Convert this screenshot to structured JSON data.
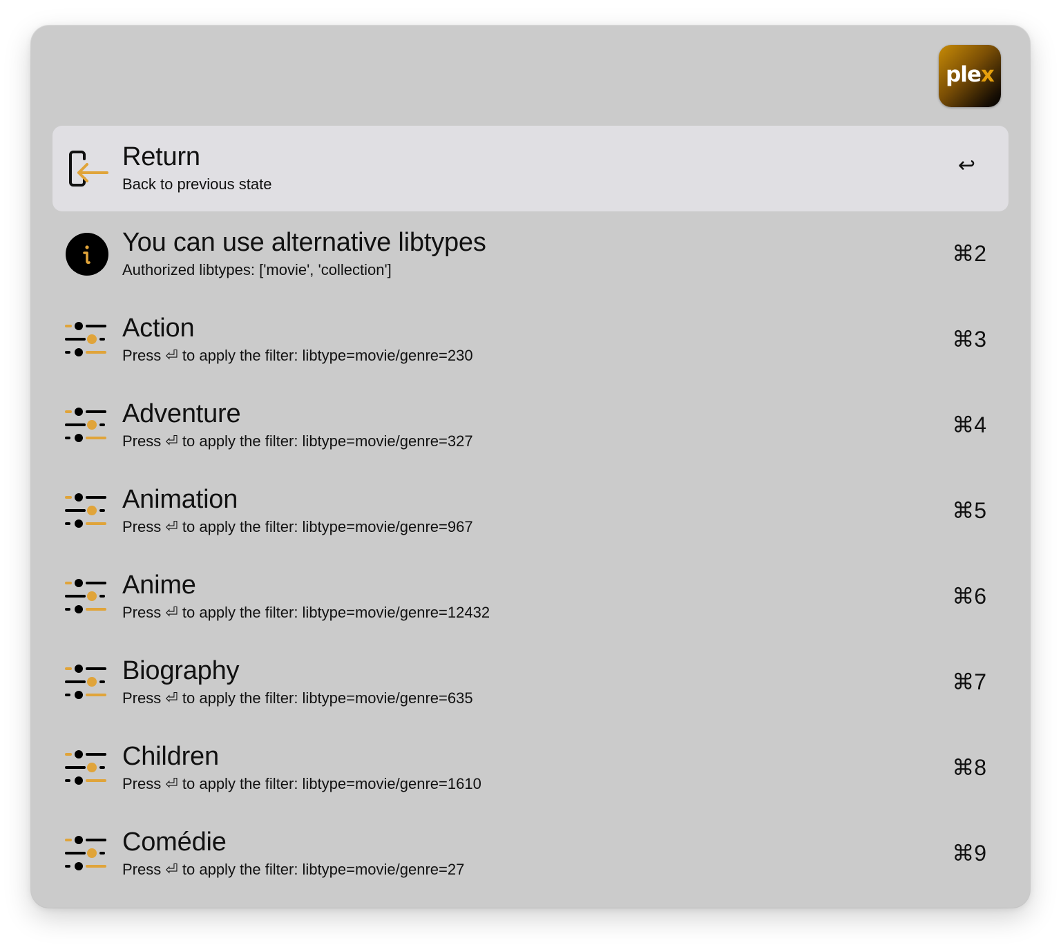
{
  "app": {
    "name": "plex",
    "logo_text_main": "ple",
    "logo_text_accent": "x",
    "accent_color": "#e5a00d"
  },
  "results": [
    {
      "icon": "return-icon",
      "title": "Return",
      "subtitle": "Back to previous state",
      "shortcut": "↩",
      "selected": true
    },
    {
      "icon": "info-icon",
      "title": "You can use alternative libtypes",
      "subtitle": "Authorized libtypes: ['movie', 'collection']",
      "shortcut": "⌘2",
      "selected": false
    },
    {
      "icon": "filter-sliders-icon",
      "title": "Action",
      "subtitle": "Press ⏎ to apply the filter: libtype=movie/genre=230",
      "shortcut": "⌘3",
      "selected": false
    },
    {
      "icon": "filter-sliders-icon",
      "title": "Adventure",
      "subtitle": "Press ⏎ to apply the filter: libtype=movie/genre=327",
      "shortcut": "⌘4",
      "selected": false
    },
    {
      "icon": "filter-sliders-icon",
      "title": "Animation",
      "subtitle": "Press ⏎ to apply the filter: libtype=movie/genre=967",
      "shortcut": "⌘5",
      "selected": false
    },
    {
      "icon": "filter-sliders-icon",
      "title": "Anime",
      "subtitle": "Press ⏎ to apply the filter: libtype=movie/genre=12432",
      "shortcut": "⌘6",
      "selected": false
    },
    {
      "icon": "filter-sliders-icon",
      "title": "Biography",
      "subtitle": "Press ⏎ to apply the filter: libtype=movie/genre=635",
      "shortcut": "⌘7",
      "selected": false
    },
    {
      "icon": "filter-sliders-icon",
      "title": "Children",
      "subtitle": "Press ⏎ to apply the filter: libtype=movie/genre=1610",
      "shortcut": "⌘8",
      "selected": false
    },
    {
      "icon": "filter-sliders-icon",
      "title": "Comédie",
      "subtitle": "Press ⏎ to apply the filter: libtype=movie/genre=27",
      "shortcut": "⌘9",
      "selected": false
    }
  ]
}
